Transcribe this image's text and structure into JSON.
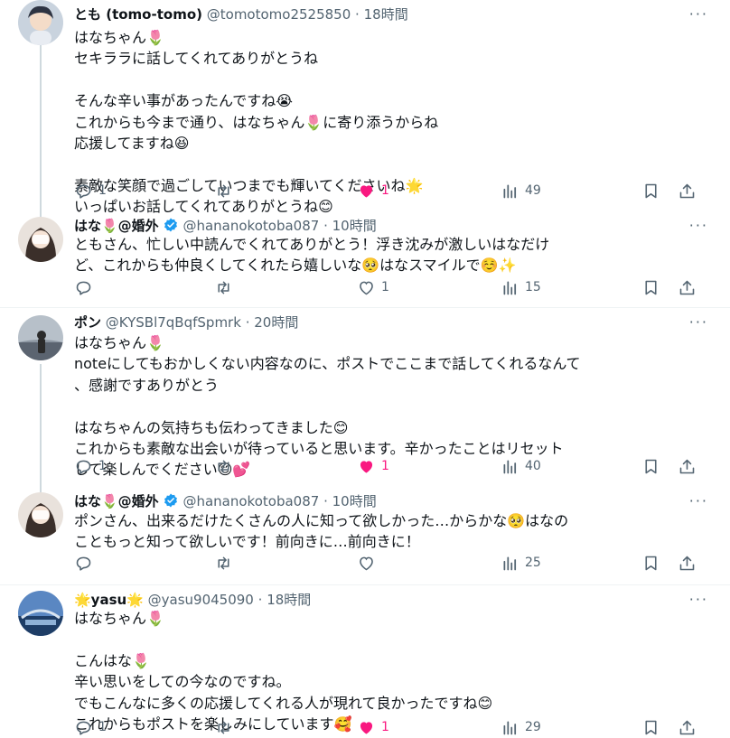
{
  "posts": [
    {
      "name": "とも (tomo-tomo)",
      "handle": "@tomotomo2525850",
      "time": "18時間",
      "lines": [
        "はなちゃん🌷",
        "セキララに話してくれてありがとうね",
        "",
        "そんな辛い事があったんですね😭",
        "これからも今まで通り、はなちゃん🌷に寄り添うからね",
        "応援してますね😆",
        "",
        "素敵な笑顔で過ごしていつまでも輝いてくださいね🌟",
        "いっぱいお話してくれてありがとうね😊"
      ],
      "replies": "1",
      "reposts": "",
      "likes": "1",
      "liked": true,
      "views": "49"
    },
    {
      "name": "はな🌷@婚外",
      "handle": "@hananokotoba087",
      "time": "10時間",
      "verified": true,
      "lines": [
        "ともさん、忙しい中読んでくれてありがとう！浮き沈みが激しいはなだけ",
        "ど、これからも仲良くしてくれたら嬉しいな🥺はなスマイルで☺️✨"
      ],
      "replies": "",
      "reposts": "",
      "likes": "1",
      "liked": false,
      "views": "15"
    },
    {
      "name": "ポン",
      "handle": "@KYSBl7qBqfSpmrk",
      "time": "20時間",
      "lines": [
        "はなちゃん🌷",
        "noteにしてもおかしくない内容なのに、ポストでここまで話してくれるなんて",
        "、感謝ですありがとう",
        "",
        "はなちゃんの気持ちも伝わってきました😊",
        "これからも素敵な出会いが待っていると思います。辛かったことはリセット",
        "して楽しんでください😊💕"
      ],
      "replies": "1",
      "reposts": "",
      "likes": "1",
      "liked": true,
      "views": "40"
    },
    {
      "name": "はな🌷@婚外",
      "handle": "@hananokotoba087",
      "time": "10時間",
      "verified": true,
      "lines": [
        "ポンさん、出来るだけたくさんの人に知って欲しかった…からかな🥺はなの",
        "こともっと知って欲しいです！前向きに…前向きに！"
      ],
      "replies": "",
      "reposts": "",
      "likes": "",
      "liked": false,
      "views": "25"
    },
    {
      "name": "🌟yasu🌟",
      "handle": "@yasu9045090",
      "time": "18時間",
      "lines": [
        "はなちゃん🌷",
        "",
        "こんはな🌷",
        "辛い思いをしての今なのですね。",
        "でもこんなに多くの応援してくれる人が現れて良かったですね😊",
        "これからもポストを楽しみにしています🥰"
      ],
      "replies": "1",
      "reposts": "",
      "likes": "1",
      "liked": true,
      "views": "29"
    }
  ],
  "colors": {
    "text": "#0f1419",
    "secondary": "#536471",
    "like": "#f91880",
    "verified": "#1d9bf0",
    "divider": "#eff3f4"
  }
}
